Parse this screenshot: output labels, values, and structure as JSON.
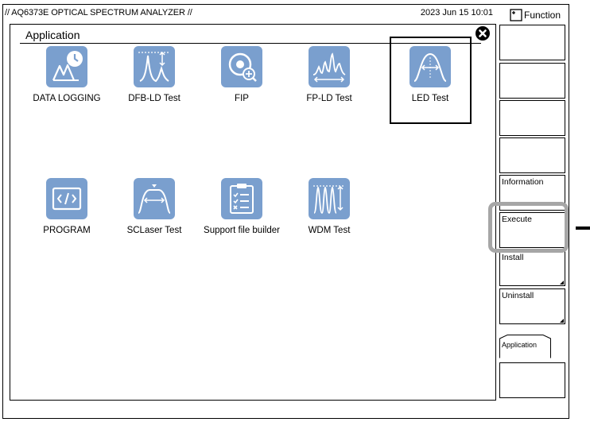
{
  "header": {
    "instrument_title": "// AQ6373E OPTICAL SPECTRUM ANALYZER //",
    "datetime": "2023 Jun 15 10:01"
  },
  "window": {
    "title": "Application"
  },
  "apps": [
    {
      "label": "DATA LOGGING",
      "icon": "data-logging-icon",
      "selected": false
    },
    {
      "label": "DFB-LD Test",
      "icon": "dfb-ld-icon",
      "selected": false
    },
    {
      "label": "FIP",
      "icon": "fip-icon",
      "selected": false
    },
    {
      "label": "FP-LD Test",
      "icon": "fp-ld-icon",
      "selected": false
    },
    {
      "label": "LED Test",
      "icon": "led-icon",
      "selected": true
    },
    {
      "label": "PROGRAM",
      "icon": "program-icon",
      "selected": false
    },
    {
      "label": "SCLaser Test",
      "icon": "sclaser-icon",
      "selected": false
    },
    {
      "label": "Support file builder",
      "icon": "support-file-icon",
      "selected": false
    },
    {
      "label": "WDM Test",
      "icon": "wdm-icon",
      "selected": false
    }
  ],
  "function_panel": {
    "header": "Function",
    "softkeys": [
      "",
      "",
      "",
      "",
      "Information",
      "Execute",
      "Install",
      "Uninstall",
      "Application",
      ""
    ]
  },
  "colors": {
    "tile": "#7a9fce",
    "highlight": "#a6a6a6"
  }
}
